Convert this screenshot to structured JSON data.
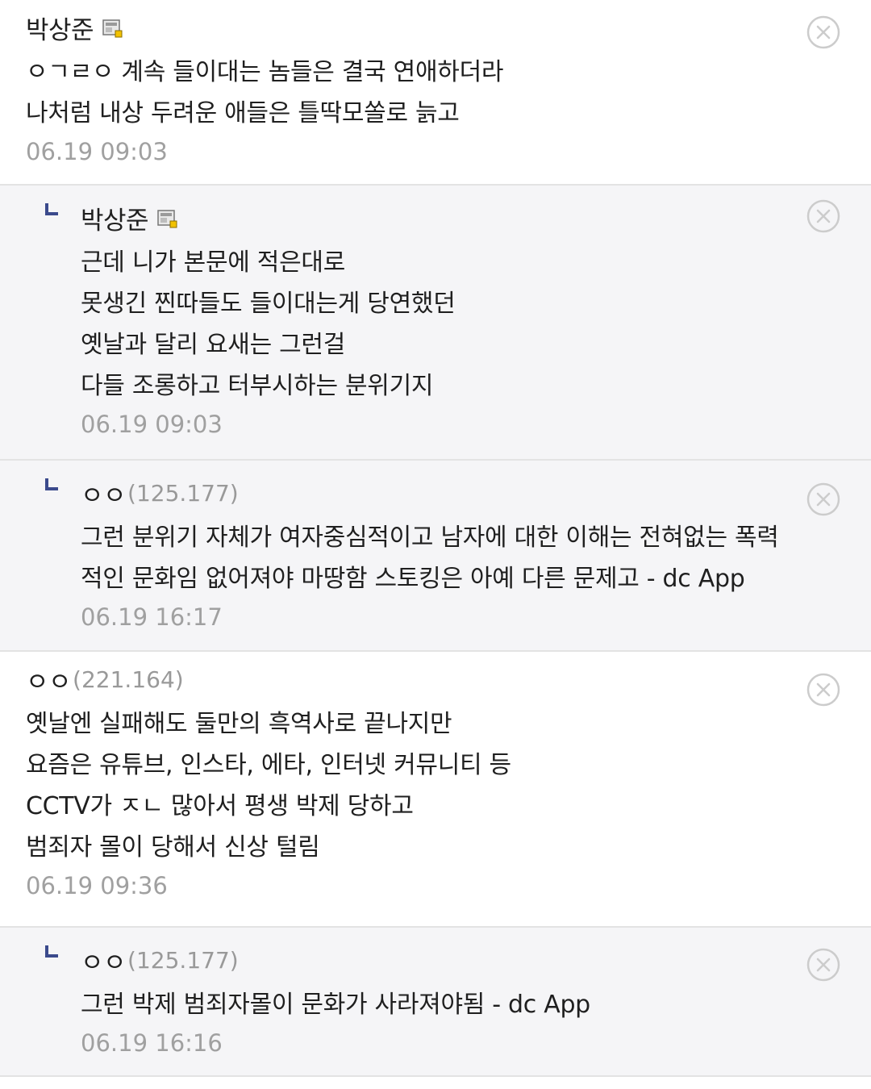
{
  "comments": [
    {
      "nickname": "박상준",
      "ip": "",
      "has_fixed_badge": true,
      "is_reply": false,
      "lines": [
        "ㅇㄱㄹㅇ 계속 들이대는 놈들은 결국 연애하더라",
        "나처럼 내상 두려운 애들은 틀딱모쏠로 늙고"
      ],
      "time": "06.19 09:03"
    },
    {
      "nickname": "박상준",
      "ip": "",
      "has_fixed_badge": true,
      "is_reply": true,
      "lines": [
        "근데 니가 본문에 적은대로",
        "못생긴 찐따들도 들이대는게 당연했던",
        "옛날과 달리 요새는 그런걸",
        "다들 조롱하고 터부시하는 분위기지"
      ],
      "time": "06.19 09:03"
    },
    {
      "nickname": "ㅇㅇ",
      "ip": "(125.177)",
      "has_fixed_badge": false,
      "is_reply": true,
      "lines": [
        "그런 분위기 자체가 여자중심적이고 남자에 대한 이해는 전혀없는 폭력",
        "적인 문화임 없어져야 마땅함 스토킹은 아예 다른 문제고 - dc App"
      ],
      "time": "06.19 16:17"
    },
    {
      "nickname": "ㅇㅇ",
      "ip": "(221.164)",
      "has_fixed_badge": false,
      "is_reply": false,
      "lines": [
        "옛날엔 실패해도 둘만의 흑역사로 끝나지만",
        "요즘은 유튜브, 인스타, 에타, 인터넷 커뮤니티 등",
        "CCTV가 ㅈㄴ 많아서 평생 박제 당하고",
        "범죄자 몰이 당해서 신상 털림"
      ],
      "time": "06.19 09:36"
    },
    {
      "nickname": "ㅇㅇ",
      "ip": "(125.177)",
      "has_fixed_badge": false,
      "is_reply": true,
      "lines": [
        "그런 박제 범죄자몰이 문화가 사라져야됨 - dc App"
      ],
      "time": "06.19 16:16"
    }
  ],
  "icons": {
    "delete": "close-circle-icon",
    "reply": "reply-arrow-icon",
    "badge": "fixed-nick-badge-icon"
  },
  "colors": {
    "reply_background": "#f5f5f7",
    "reply_marker": "#3b4a8c",
    "time_text": "#a0a0a0",
    "ip_text": "#999999",
    "divider": "#e3e3e3",
    "delete_icon": "#cccccc"
  }
}
